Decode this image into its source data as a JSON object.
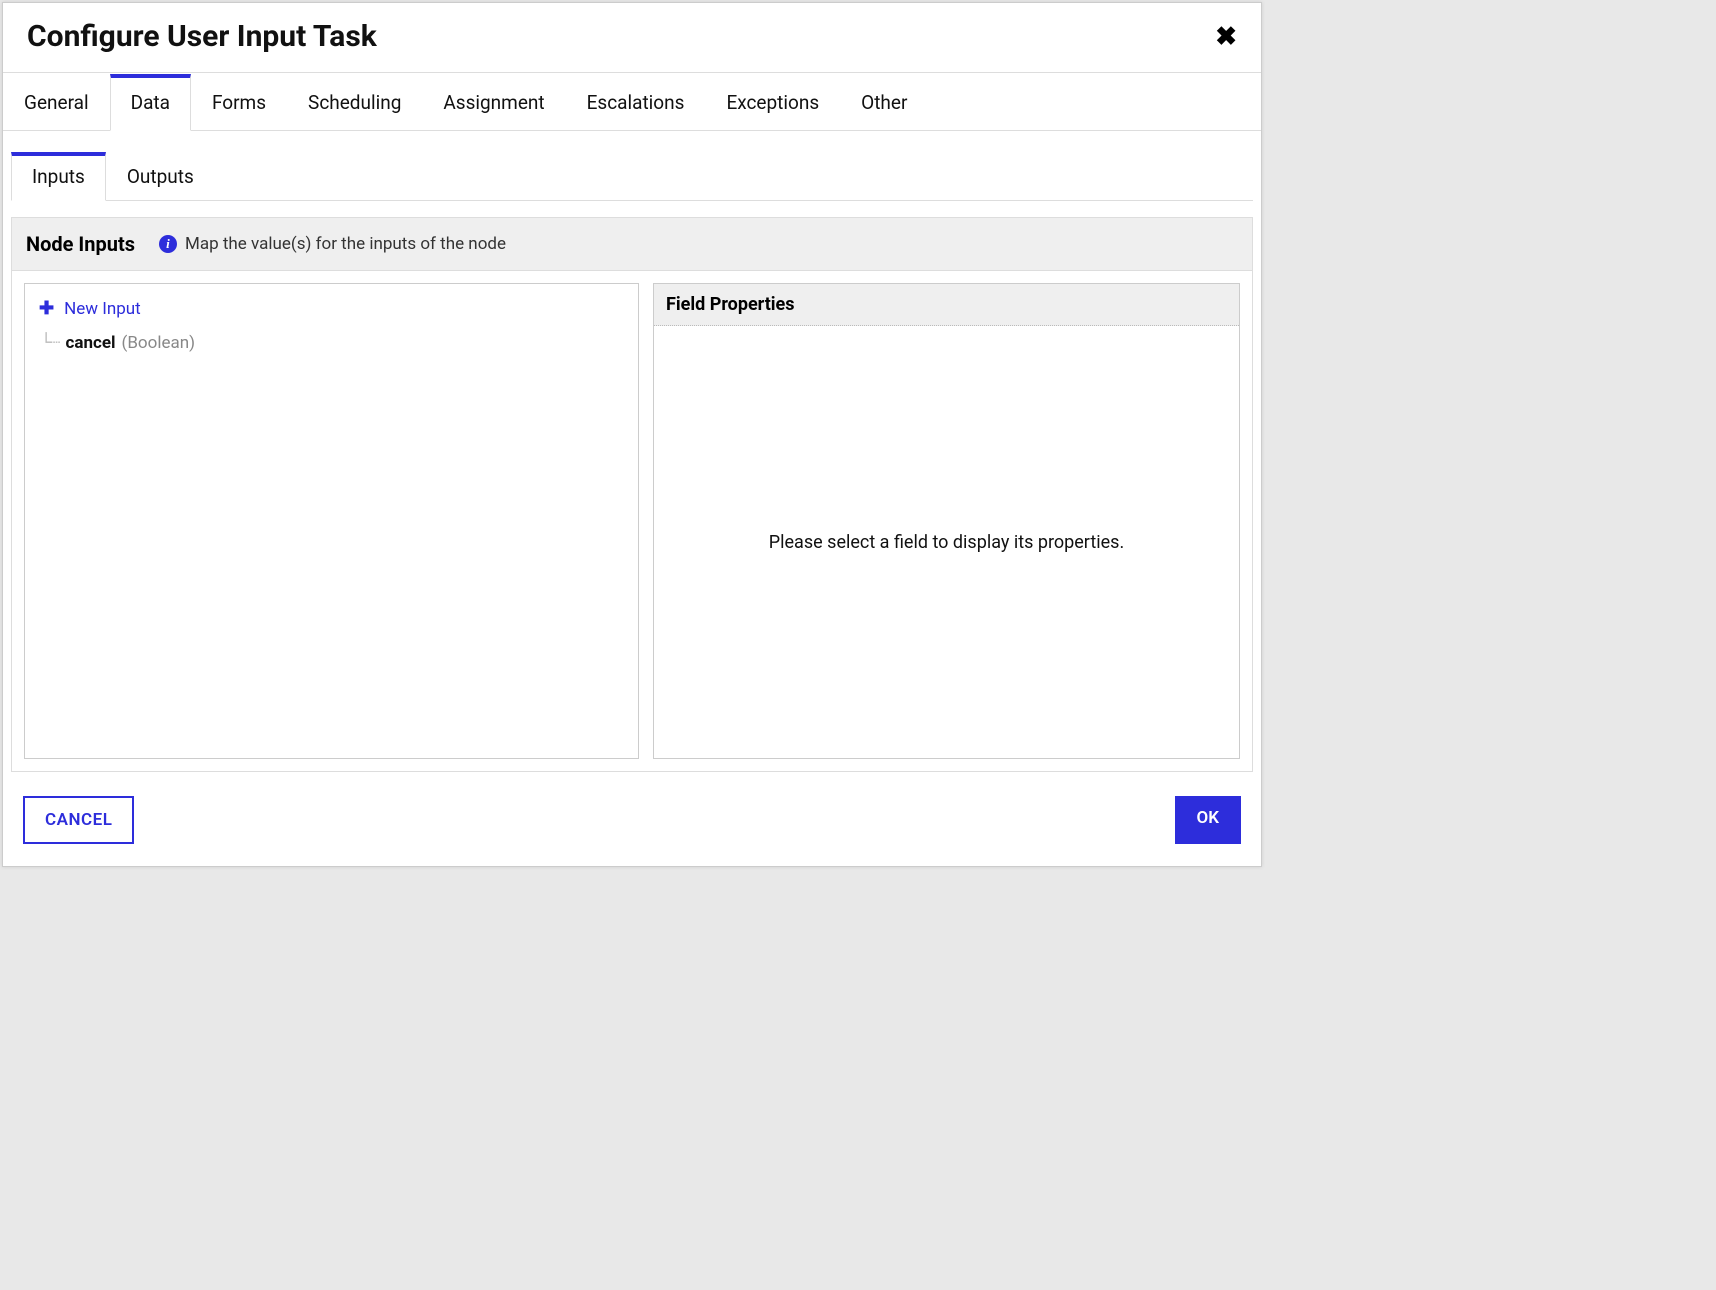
{
  "dialog": {
    "title": "Configure User Input Task"
  },
  "tabs": {
    "general": "General",
    "data": "Data",
    "forms": "Forms",
    "scheduling": "Scheduling",
    "assignment": "Assignment",
    "escalations": "Escalations",
    "exceptions": "Exceptions",
    "other": "Other"
  },
  "subtabs": {
    "inputs": "Inputs",
    "outputs": "Outputs"
  },
  "section": {
    "title": "Node Inputs",
    "hint": "Map the value(s) for the inputs of the node"
  },
  "leftPane": {
    "newInputLabel": "New Input",
    "items": [
      {
        "name": "cancel",
        "type": "(Boolean)"
      }
    ]
  },
  "rightPane": {
    "header": "Field Properties",
    "placeholder": "Please select a field to display its properties."
  },
  "footer": {
    "cancel": "CANCEL",
    "ok": "OK"
  }
}
